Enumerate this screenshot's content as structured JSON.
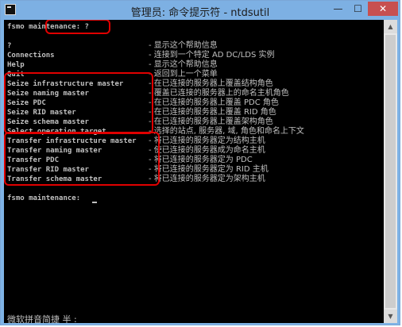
{
  "window": {
    "title": "管理员: 命令提示符 - ntdsutil",
    "buttons": {
      "minimize": "—",
      "maximize": "☐",
      "close": "✕"
    }
  },
  "console": {
    "prompt_line": "fsmo maintenance: ?",
    "help_rows": [
      {
        "cmd": "?",
        "desc": "- 显示这个帮助信息"
      },
      {
        "cmd": "Connections",
        "desc": "- 连接到一个特定 AD DC/LDS 实例"
      },
      {
        "cmd": "Help",
        "desc": "- 显示这个帮助信息"
      },
      {
        "cmd": "Quit",
        "desc": "- 返回到上一个菜单"
      },
      {
        "cmd": "Seize infrastructure master",
        "desc": "- 在已连接的服务器上覆盖结构角色"
      },
      {
        "cmd": "Seize naming master",
        "desc": "- 覆盖已连接的服务器上的命名主机角色"
      },
      {
        "cmd": "Seize PDC",
        "desc": "- 在已连接的服务器上覆盖 PDC 角色"
      },
      {
        "cmd": "Seize RID master",
        "desc": "- 在已连接的服务器上覆盖 RID 角色"
      },
      {
        "cmd": "Seize schema master",
        "desc": "- 在已连接的服务器上覆盖架构角色"
      },
      {
        "cmd": "Select operation target",
        "desc": "- 选择的站点, 服务器, 域, 角色和命名上下文"
      },
      {
        "cmd": "Transfer infrastructure master",
        "desc": "- 将已连接的服务器定为结构主机"
      },
      {
        "cmd": "Transfer naming master",
        "desc": "- 使已连接的服务器成为命名主机"
      },
      {
        "cmd": "Transfer PDC",
        "desc": "- 将已连接的服务器定为 PDC"
      },
      {
        "cmd": "Transfer RID master",
        "desc": "- 将已连接的服务器定为 RID 主机"
      },
      {
        "cmd": "Transfer schema master",
        "desc": "- 将已连接的服务器定为架构主机"
      }
    ],
    "final_prompt": "fsmo maintenance:",
    "ime_status": "微软拼音简捷 半 :"
  },
  "highlight_color": "#e00000"
}
